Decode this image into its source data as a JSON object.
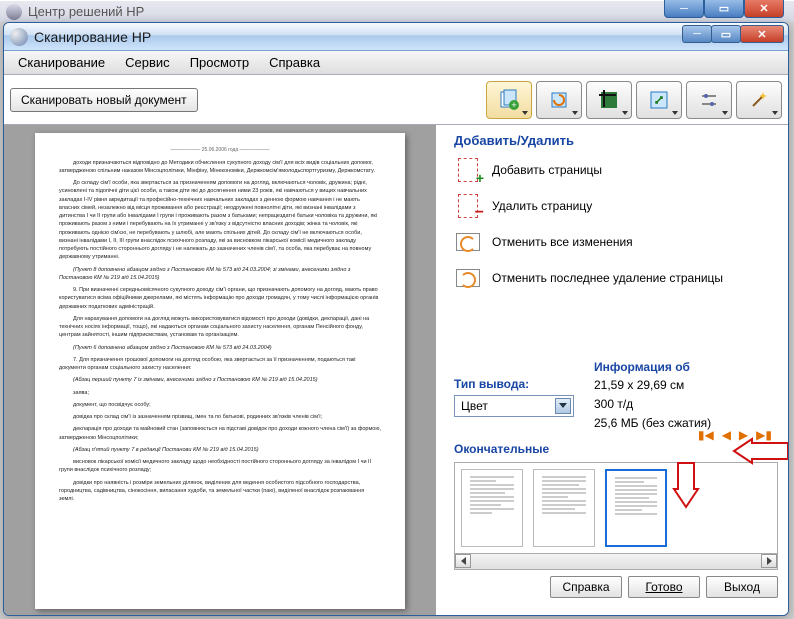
{
  "parent_window": {
    "title": "Центр решений HP"
  },
  "window": {
    "title": "Сканирование HP"
  },
  "menu": {
    "scan": "Сканирование",
    "service": "Сервис",
    "view": "Просмотр",
    "help": "Справка"
  },
  "toolbar": {
    "scan_new": "Сканировать новый документ"
  },
  "sections": {
    "add_remove": "Добавить/Удалить",
    "actions": {
      "add_pages": "Добавить страницы",
      "delete_page": "Удалить страницу",
      "undo_all": "Отменить все изменения",
      "undo_last_delete": "Отменить последнее удаление страницы"
    },
    "output_type_label": "Тип вывода:",
    "output_type_value": "Цвет",
    "info_label": "Информация об",
    "info": {
      "size": "21,59 x 29,69 см",
      "dpi": "300 т/д",
      "filesize": "25,6 МБ (без сжатия)"
    },
    "final_label": "Окончательные"
  },
  "buttons": {
    "help": "Справка",
    "done": "Готово",
    "exit": "Выход"
  },
  "document_text": {
    "l0": "—————— 25.06.2006 года ——————",
    "l1": "доходи призначаються відповідно до Методики обчислення сукупного доходу сім'ї для всіх видів соціальних допомог, затвердженою спільним наказом Мінсоцполітики, Мінфіну, Мінекономіки, Держкомсім'ямолодьспорттуризму, Держкомстату.",
    "l2": "До складу сім'ї особи, яка звертається за призначенням допомоги на догляд, включаються чоловік, дружина; рідні, усиновлені та підопічні діти цієї особи, а також діти які до досягнення ними 23 років, які навчаються у вищих навчальних закладах І-IV рівня акредитації та професійно-технічних навчальних закладах з денною формою навчання і не мають власних сімей, незалежно від місця проживання або реєстрації; неодружені повнолітні діти, які визнані інвалідами з дитинства І чи ІІ групи або інвалідами І групи і проживають разом з батьками; непрацездатні батьки чоловіка та дружини, які проживають разом з ними і перебувають на їх утриманні у зв'язку з відсутністю власних доходів; жінка та чоловік, які проживають однією сім'єю, не перебувають у шлюбі, але мають спільних дітей. До складу сім'ї не включаються особи, визнані інвалідами І, ІІ, ІІІ групи внаслідок психічного розладу, які за висновком лікарської комісії медичного закладу потребують постійного стороннього догляду і не належать до зазначених членів сім'ї, та особа, яка перебуває на повному державному утриманні.",
    "l3": "(Пункт 8 доповнено абзацом згідно з Постановою КМ № 573 від 24.03.2004; зі змінами, внесеними згідно з Постановою КМ № 219 від 15.04.2015)",
    "l4": "9. При визначенні середньомісячного сукупного доходу сім'ї органи, що призначають допомогу на догляд, мають право користуватися всіма офіційними джерелами, які містять інформацію про доходи громадян, у тому числі інформацією органів державних податкових адміністрацій.",
    "l5": "Для нарахування допомоги на догляд можуть використовуватися відомості про доходи (довідки, декларації, дані на технічних носіях інформації, тощо), які надаються органам соціального захисту населення, органам Пенсійного фонду, центрам зайнятості, іншим підприємствам, установам та організаціям.",
    "l6": "(Пункт 6 доповнено абзацом згідно з Постановою КМ № 573 від 24.03.2004)",
    "l7": "7. Для призначення грошової допомоги на догляд особою, яка звертається за її призначенням, подаються такі документи органам соціального захисту населення:",
    "l8": "(Абзац перший пункту 7 із змінами, внесеними згідно з Постановою КМ № 219 від 15.04.2015)",
    "l9": "заява;",
    "l10": "документ, що посвідчує особу;",
    "l11": "довідка про склад сім'ї із зазначенням прізвищ, імен та по батькові, родинних зв'язків членів сім'ї;",
    "l12": "декларація про доходи та майновий стан (заповнюється на підставі довідок про доходи кожного члена сім'ї) за формою, затвердженою Мінсоцполітики;",
    "l13": "(Абзац п'ятий пункту 7 в редакції Постанови КМ № 219 від 15.04.2015)",
    "l14": "висновок лікарської комісії медичного закладу щодо необхідності постійного стороннього догляду за інвалідом І чи ІІ групи внаслідок психічного розладу;",
    "l15": "довідки про наявність і розміри земельних ділянок, виділених для ведення особистого підсобного господарства, городництва, садівництва, сінокосіння, випасання худоби, та земельної частки (паю), виділеної внаслідок розпаювання землі."
  }
}
